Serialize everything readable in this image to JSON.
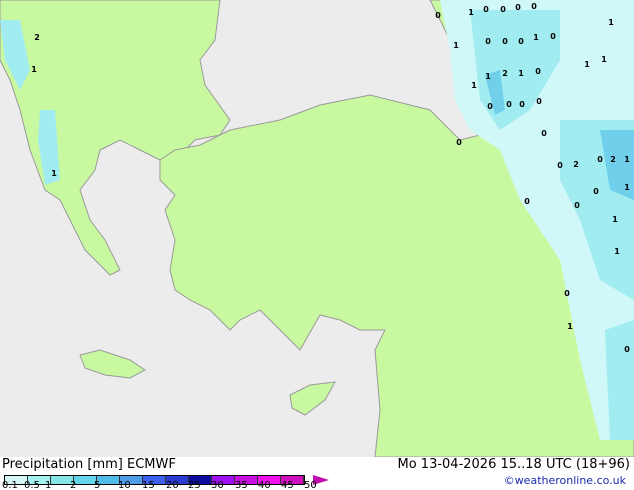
{
  "map": {
    "colors": {
      "sea": "#ececec",
      "land": "#c8f8a0",
      "border": "#9a9a9a",
      "light_precip": "#d0f8f8",
      "mid_precip": "#a0ecf0",
      "heavy_precip": "#70d0ec",
      "core_precip": "#50b4e8"
    },
    "precip_labels": [
      "0",
      "1",
      "0",
      "0",
      "0",
      "0",
      "1",
      "2",
      "1",
      "1",
      "0",
      "0",
      "0",
      "1",
      "0",
      "1",
      "1",
      "1",
      "2",
      "1",
      "0",
      "1",
      "0",
      "0",
      "0",
      "0",
      "1",
      "0",
      "0",
      "0",
      "2",
      "0",
      "2",
      "1",
      "0",
      "1",
      "1",
      "0",
      "0",
      "1",
      "0",
      "0",
      "1"
    ]
  },
  "footer": {
    "title": "Precipitation [mm]  ECMWF",
    "datetime": "Mo 13-04-2026 15..18 UTC (18+96)",
    "credit": "©weatheronline.co.uk",
    "scale_ticks": [
      "0.1",
      "0.5",
      "1",
      "2",
      "5",
      "10",
      "15",
      "20",
      "25",
      "30",
      "35",
      "40",
      "45",
      "50"
    ],
    "scale_colors": [
      "#d4f8f8",
      "#a4f2f2",
      "#84e6e6",
      "#64d6ec",
      "#50bce8",
      "#4c9ce8",
      "#3c60f0",
      "#2c3cd0",
      "#0c0ca0",
      "#a010f0",
      "#c810e0",
      "#f010f0",
      "#d010c0"
    ]
  }
}
